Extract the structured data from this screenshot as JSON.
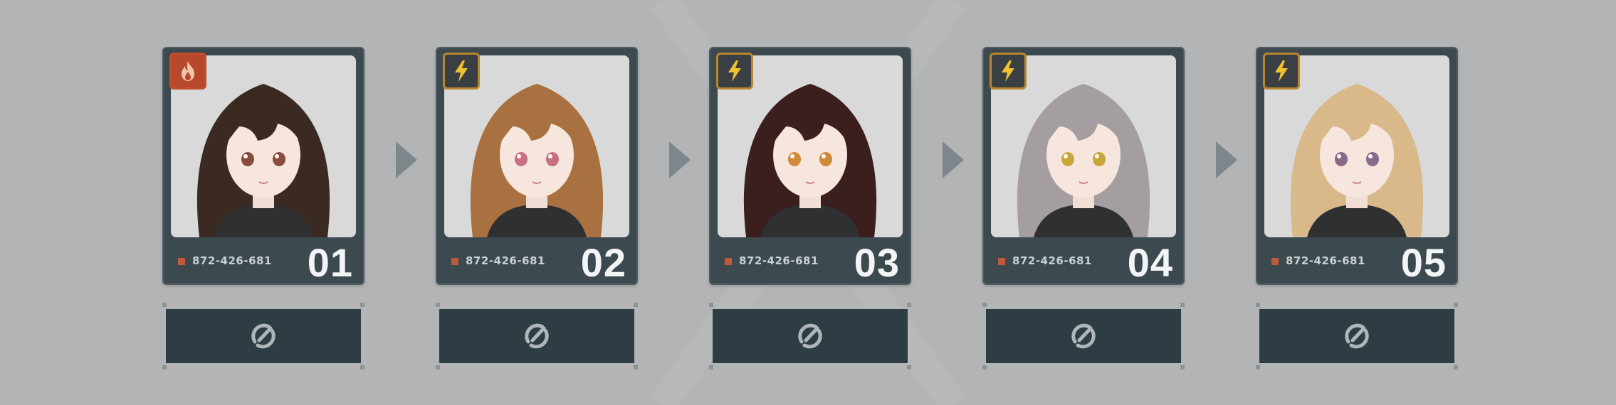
{
  "colors": {
    "background": "#b3b4b6",
    "card": "#3c4a50",
    "button": "#2e3d43",
    "fire_badge": "#b8482b",
    "electric_badge_border": "#b8872e",
    "bolt": "#f2c12e",
    "code_marker": "#c0583a"
  },
  "cards": [
    {
      "number": "01",
      "code": "872-426-681",
      "element_icon": "flame-icon",
      "hair": "#3a2a22",
      "eyes": "#8a4b3a",
      "action_icon": "swap-icon"
    },
    {
      "number": "02",
      "code": "872-426-681",
      "element_icon": "lightning-icon",
      "hair": "#a8713f",
      "eyes": "#c86f82",
      "action_icon": "swap-icon"
    },
    {
      "number": "03",
      "code": "872-426-681",
      "element_icon": "lightning-icon",
      "hair": "#3b1f1e",
      "eyes": "#d08a3a",
      "action_icon": "swap-icon"
    },
    {
      "number": "04",
      "code": "872-426-681",
      "element_icon": "lightning-icon",
      "hair": "#a59ea0",
      "eyes": "#c9a63a",
      "action_icon": "swap-icon"
    },
    {
      "number": "05",
      "code": "872-426-681",
      "element_icon": "lightning-icon",
      "hair": "#d9b88a",
      "eyes": "#8a6a8a",
      "action_icon": "swap-icon"
    }
  ],
  "separator_icon": "chevron-right-icon"
}
